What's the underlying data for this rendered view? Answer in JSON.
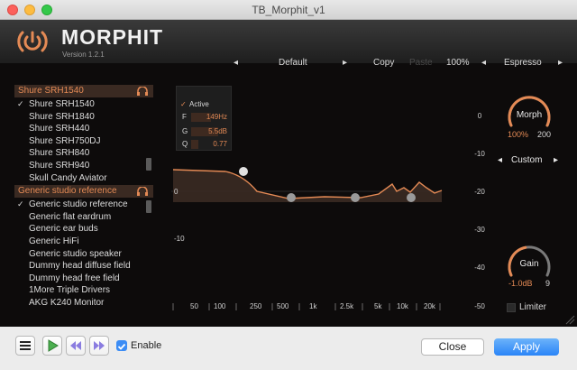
{
  "window": {
    "title": "TB_Morphit_v1"
  },
  "header": {
    "brand": "MORPHIT",
    "version": "Version 1.2.1"
  },
  "topbar": {
    "prev_arrow": "◂",
    "preset": "Default",
    "next_arrow": "▸",
    "copy": "Copy",
    "paste": "Paste",
    "zoom": "100%",
    "skin_prev": "◂",
    "skin": "Espresso",
    "skin_next": "▸"
  },
  "targets": {
    "group1": "Shure SRH1540",
    "group1_items": [
      "Shure SRH1540",
      "Shure SRH1840",
      "Shure SRH440",
      "Shure SRH750DJ",
      "Shure SRH840",
      "Shure SRH940",
      "Skull Candy Aviator"
    ],
    "group2": "Generic studio reference",
    "group2_items": [
      "Generic studio reference",
      "Generic flat eardrum",
      "Generic ear buds",
      "Generic HiFi",
      "Generic studio speaker",
      "Dummy head diffuse field",
      "Dummy head free field",
      "1More Triple Drivers",
      "AKG K240 Monitor"
    ],
    "check": "✓"
  },
  "filter_panel": {
    "active_label": "Active",
    "check": "✓",
    "f_label": "F",
    "f_value": "149Hz",
    "f_fill": 0.55,
    "g_label": "G",
    "g_value": "5.5dB",
    "g_fill": 0.75,
    "q_label": "Q",
    "q_value": "0.77",
    "q_fill": 0.2
  },
  "eq": {
    "db_labels": [
      "0",
      "-10"
    ],
    "freq_labels": [
      "50",
      "100",
      "250",
      "500",
      "1k",
      "2.5k",
      "5k",
      "10k",
      "20k"
    ],
    "right_scale": [
      "0",
      "-10",
      "-20",
      "-30",
      "-40",
      "-50"
    ]
  },
  "morph": {
    "label": "Morph",
    "value": "100%",
    "secondary": "200",
    "level": 1.0
  },
  "mode": {
    "prev": "◂",
    "label": "Custom",
    "next": "▸"
  },
  "gain": {
    "label": "Gain",
    "value": "-1.0dB",
    "secondary": "9",
    "level": 0.45
  },
  "limiter": {
    "label": "Limiter"
  },
  "footer": {
    "enable": "Enable",
    "close": "Close",
    "apply": "Apply"
  },
  "colors": {
    "accent": "#e48a55",
    "apply": "#3b8cf5",
    "bg": "#0d0b0b"
  }
}
